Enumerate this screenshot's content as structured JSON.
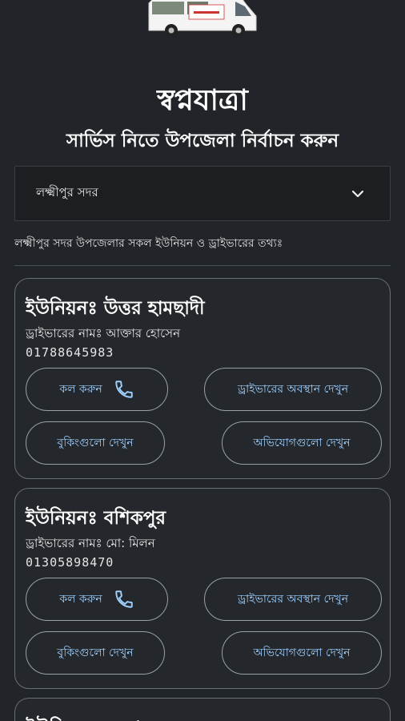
{
  "header": {
    "app_title": "স্বপ্নযাত্রা",
    "subtitle": "সার্ভিস নিতে উপজেলা নির্বাচন করুন"
  },
  "dropdown": {
    "selected": "লক্ষ্মীপুর সদর",
    "icon": "chevron-down-icon"
  },
  "info_text": "লক্ষ্মীপুর সদর উপজেলার সকল ইউনিয়ন ও ড্রাইভারের তথ্যঃ",
  "cards": [
    {
      "title": "ইউনিয়নঃ উত্তর হামছাদী",
      "driver": "ড্রাইভারের নামঃ আক্তার হোসেন",
      "phone": "01788645983",
      "call_label": "কল করুন",
      "location_label": "ড্রাইভারের অবস্থান দেখুন",
      "bookings_label": "বুকিংগুলো দেখুন",
      "complaints_label": "অভিযোগগুলো দেখুন"
    },
    {
      "title": "ইউনিয়নঃ বশিকপুর",
      "driver": "ড্রাইভারের নামঃ মো: মিলন",
      "phone": "01305898470",
      "call_label": "কল করুন",
      "location_label": "ড্রাইভারের অবস্থান দেখুন",
      "bookings_label": "বুকিংগুলো দেখুন",
      "complaints_label": "অভিযোগগুলো দেখুন"
    },
    {
      "title": "ইউনিয়নঃ চন্দ্রগঞ্জ"
    }
  ],
  "colors": {
    "background": "#212428",
    "accent": "#9fd0ff",
    "card_border": "#6a6e75"
  }
}
